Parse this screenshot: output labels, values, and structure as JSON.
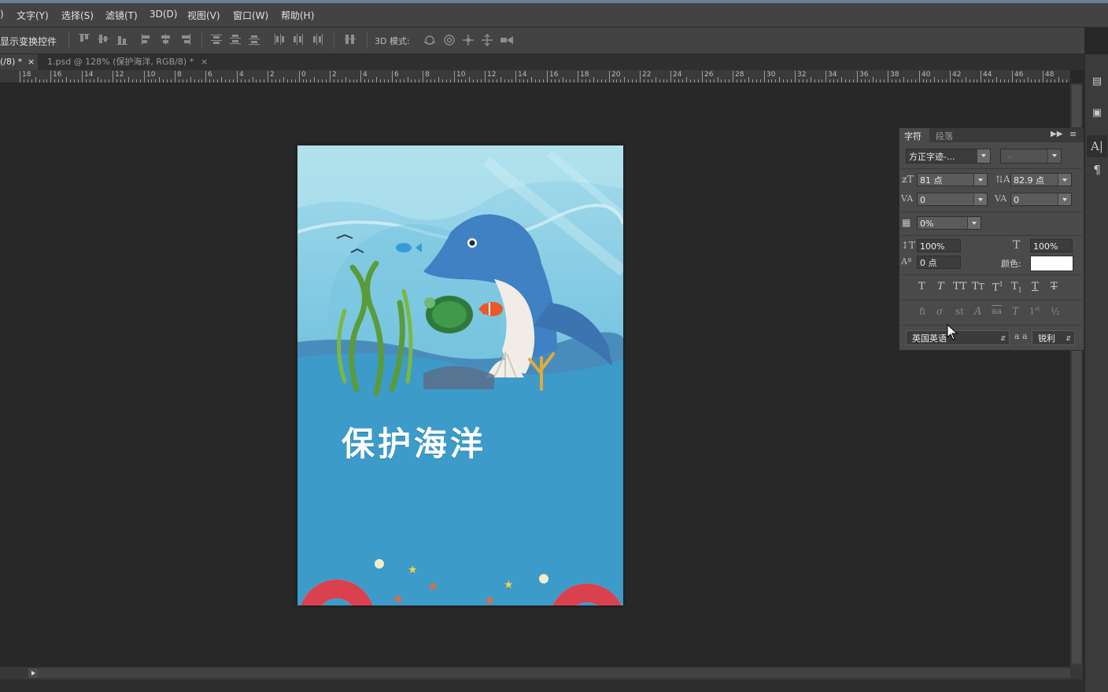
{
  "menubar": {
    "items": [
      ")",
      "文字(Y)",
      "选择(S)",
      "滤镜(T)",
      "3D(D)",
      "视图(V)",
      "窗口(W)",
      "帮助(H)"
    ]
  },
  "optionsbar": {
    "show_transform_label": "显示变换控件",
    "mode_3d_label": "3D 模式:"
  },
  "tabs": [
    {
      "label": "(/8) *",
      "close": "×",
      "active": true
    },
    {
      "label": "1.psd @ 128% (保护海洋, RGB/8) *",
      "close": "×",
      "active": false
    }
  ],
  "ruler": {
    "labels": [
      "18",
      "16",
      "14",
      "12",
      "10",
      "8",
      "6",
      "4",
      "2",
      "0",
      "2",
      "4",
      "6",
      "8",
      "10",
      "12",
      "14",
      "16",
      "18",
      "20",
      "22",
      "24",
      "26",
      "28",
      "30",
      "32",
      "34",
      "36",
      "38",
      "40",
      "42",
      "44",
      "46",
      "48"
    ]
  },
  "canvas": {
    "title_text": "保护海洋",
    "colors": {
      "sky": "#8fd3e6",
      "sea": "#3c9bc8",
      "dolphin": "#3f81c2",
      "lifebuoy": "#d9414e"
    }
  },
  "character_panel": {
    "tab_character": "字符",
    "tab_paragraph": "段落",
    "font_family": "方正字迹-...",
    "font_style": "-",
    "font_size": "81 点",
    "leading": "82.9 点",
    "kerning": "0",
    "tracking": "0",
    "tsume": "0%",
    "vertical_scale": "100%",
    "horizontal_scale": "100%",
    "baseline_shift": "0 点",
    "color_label": "颜色:",
    "text_color": "#ffffff",
    "language": "英国英语",
    "aa_label": "a a",
    "antialias": "锐利"
  }
}
